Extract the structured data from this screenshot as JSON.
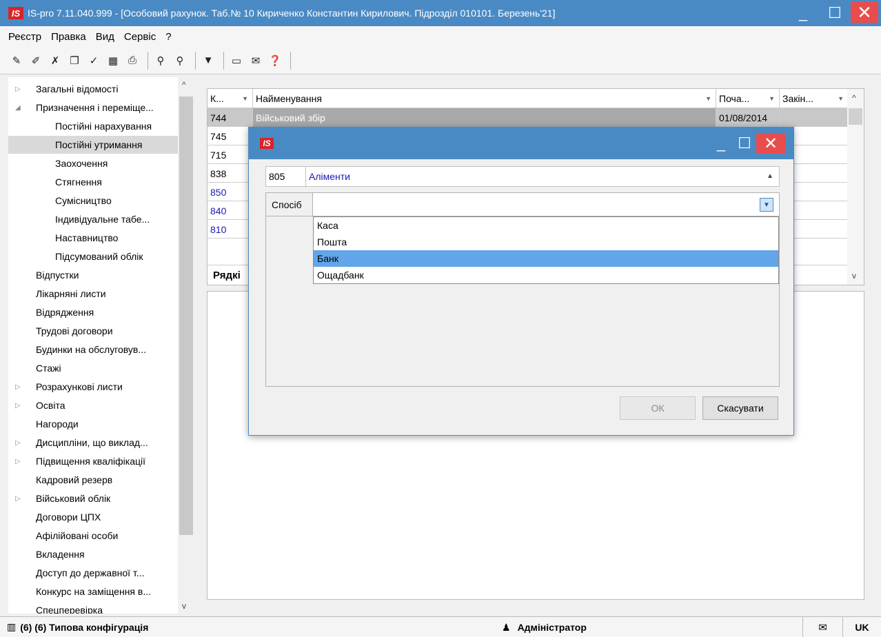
{
  "window": {
    "title": "IS-pro 7.11.040.999 - [Особовий рахунок. Таб.№ 10 Кириченко Константин Кирилович. Підрозділ 010101. Березень'21]",
    "logo_text": "IS"
  },
  "menu": [
    "Реєстр",
    "Правка",
    "Вид",
    "Сервіс",
    "?"
  ],
  "tree": {
    "items": [
      {
        "label": "Загальні відомості",
        "expander": "▷"
      },
      {
        "label": "Призначення і переміще...",
        "expander": "◢"
      },
      {
        "label": "Постійні нарахування",
        "expander": ""
      },
      {
        "label": "Постійні утримання",
        "expander": ""
      },
      {
        "label": "Заохочення",
        "expander": ""
      },
      {
        "label": "Стягнення",
        "expander": ""
      },
      {
        "label": "Сумісництво",
        "expander": ""
      },
      {
        "label": "Індивідуальне табе...",
        "expander": ""
      },
      {
        "label": "Наставництво",
        "expander": ""
      },
      {
        "label": "Підсумований облік",
        "expander": ""
      },
      {
        "label": "Відпустки",
        "expander": ""
      },
      {
        "label": "Лікарняні листи",
        "expander": ""
      },
      {
        "label": "Відрядження",
        "expander": ""
      },
      {
        "label": "Трудові договори",
        "expander": ""
      },
      {
        "label": "Будинки на обслуговув...",
        "expander": ""
      },
      {
        "label": "Стажі",
        "expander": ""
      },
      {
        "label": "Розрахункові листи",
        "expander": "▷"
      },
      {
        "label": "Освіта",
        "expander": "▷"
      },
      {
        "label": "Нагороди",
        "expander": ""
      },
      {
        "label": "Дисципліни, що виклад...",
        "expander": "▷"
      },
      {
        "label": "Підвищення кваліфікації",
        "expander": "▷"
      },
      {
        "label": "Кадровий резерв",
        "expander": ""
      },
      {
        "label": "Військовий облік",
        "expander": "▷"
      },
      {
        "label": "Договори ЦПХ",
        "expander": ""
      },
      {
        "label": "Афілійовані особи",
        "expander": ""
      },
      {
        "label": "Вкладення",
        "expander": ""
      },
      {
        "label": "Доступ до державної т...",
        "expander": ""
      },
      {
        "label": "Конкурс на заміщення в...",
        "expander": ""
      },
      {
        "label": "Спецперевірка",
        "expander": ""
      }
    ]
  },
  "grid": {
    "headers": [
      "К...",
      "Найменування",
      "Поча...",
      "Закін..."
    ],
    "rows": [
      {
        "code": "744",
        "name": "Військовий збір",
        "start": "01/08/2014",
        "end": ""
      },
      {
        "code": "745",
        "name": "",
        "start": "",
        "end": ""
      },
      {
        "code": "715",
        "name": "",
        "start": "",
        "end": ""
      },
      {
        "code": "838",
        "name": "",
        "start": "",
        "end": ""
      },
      {
        "code": "850",
        "name": "",
        "start": "",
        "end": ""
      },
      {
        "code": "840",
        "name": "",
        "start": "",
        "end": ""
      },
      {
        "code": "810",
        "name": "",
        "start": "",
        "end": ""
      }
    ],
    "footer_label": "Рядкі"
  },
  "dialog": {
    "logo_text": "IS",
    "code": "805",
    "name": "Аліменти",
    "sposib_label": "Спосіб",
    "sposib_value": "",
    "options": [
      "Каса",
      "Пошта",
      "Банк",
      "Ощадбанк"
    ],
    "selected_option": "Банк",
    "ok_label": "ОК",
    "cancel_label": "Скасувати"
  },
  "statusbar": {
    "config": "(6) (6) Типова конфігурація",
    "user": "Адміністратор",
    "lang": "UK"
  },
  "colors": {
    "titlebar": "#4a8ac4",
    "close": "#e84c4c",
    "selected_option": "#62a5e8",
    "link_blue": "#1a1ab0"
  }
}
